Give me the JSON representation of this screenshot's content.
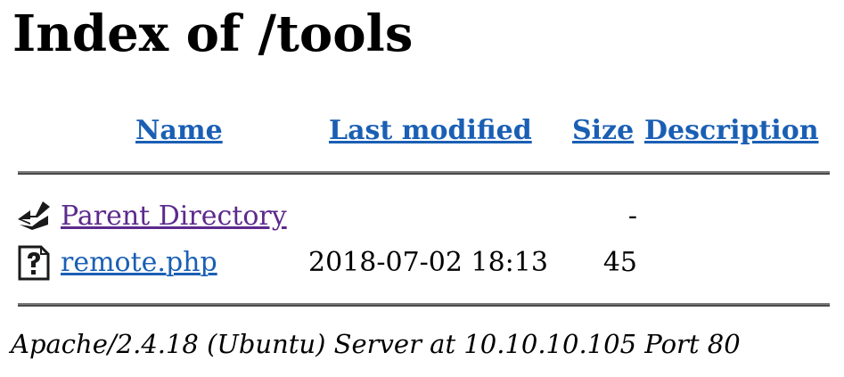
{
  "page": {
    "title": "Index of /tools"
  },
  "table": {
    "headers": {
      "name": "Name",
      "last_modified": "Last modified",
      "size": "Size",
      "description": "Description"
    },
    "rows": [
      {
        "icon": "back-arrow-icon",
        "name": "Parent Directory",
        "last_modified": "",
        "size": "-",
        "description": ""
      },
      {
        "icon": "unknown-file-icon",
        "name": "remote.php",
        "last_modified": "2018-07-02 18:13",
        "size": "45",
        "description": ""
      }
    ]
  },
  "footer": {
    "signature": "Apache/2.4.18 (Ubuntu) Server at 10.10.10.105 Port 80"
  },
  "colors": {
    "link": "#1a5fb4",
    "visited_link": "#5c2a8c"
  }
}
